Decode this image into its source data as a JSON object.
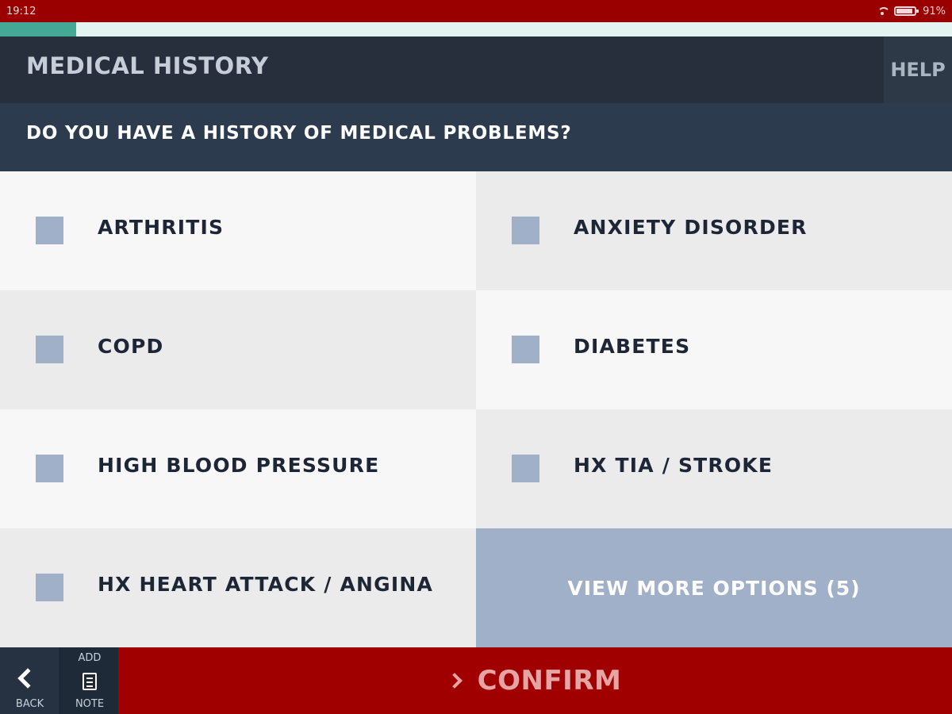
{
  "status_bar": {
    "time": "19:12",
    "battery_text": "91%",
    "wifi_icon": "wifi-icon",
    "battery_icon": "battery-icon"
  },
  "progress": {
    "fraction": 0.08,
    "color": "#44a894"
  },
  "header": {
    "title": "MEDICAL HISTORY",
    "help_label": "HELP"
  },
  "question": "DO YOU HAVE A HISTORY OF MEDICAL PROBLEMS?",
  "options": [
    {
      "label": "ARTHRITIS",
      "checked": false
    },
    {
      "label": "ANXIETY DISORDER",
      "checked": false
    },
    {
      "label": "COPD",
      "checked": false
    },
    {
      "label": "DIABETES",
      "checked": false
    },
    {
      "label": "HIGH BLOOD PRESSURE",
      "checked": false
    },
    {
      "label": "HX TIA / STROKE",
      "checked": false
    },
    {
      "label": "HX HEART ATTACK / ANGINA",
      "checked": false
    }
  ],
  "view_more_label": "VIEW MORE OPTIONS (5)",
  "bottom_bar": {
    "back_label": "BACK",
    "add_label": "ADD",
    "note_label": "NOTE",
    "confirm_label": "CONFIRM"
  },
  "colors": {
    "brand_red": "#9a0000",
    "header_dark": "#262f3b",
    "question_bg": "#2c3b4e",
    "checkbox": "#9fb0c8"
  }
}
